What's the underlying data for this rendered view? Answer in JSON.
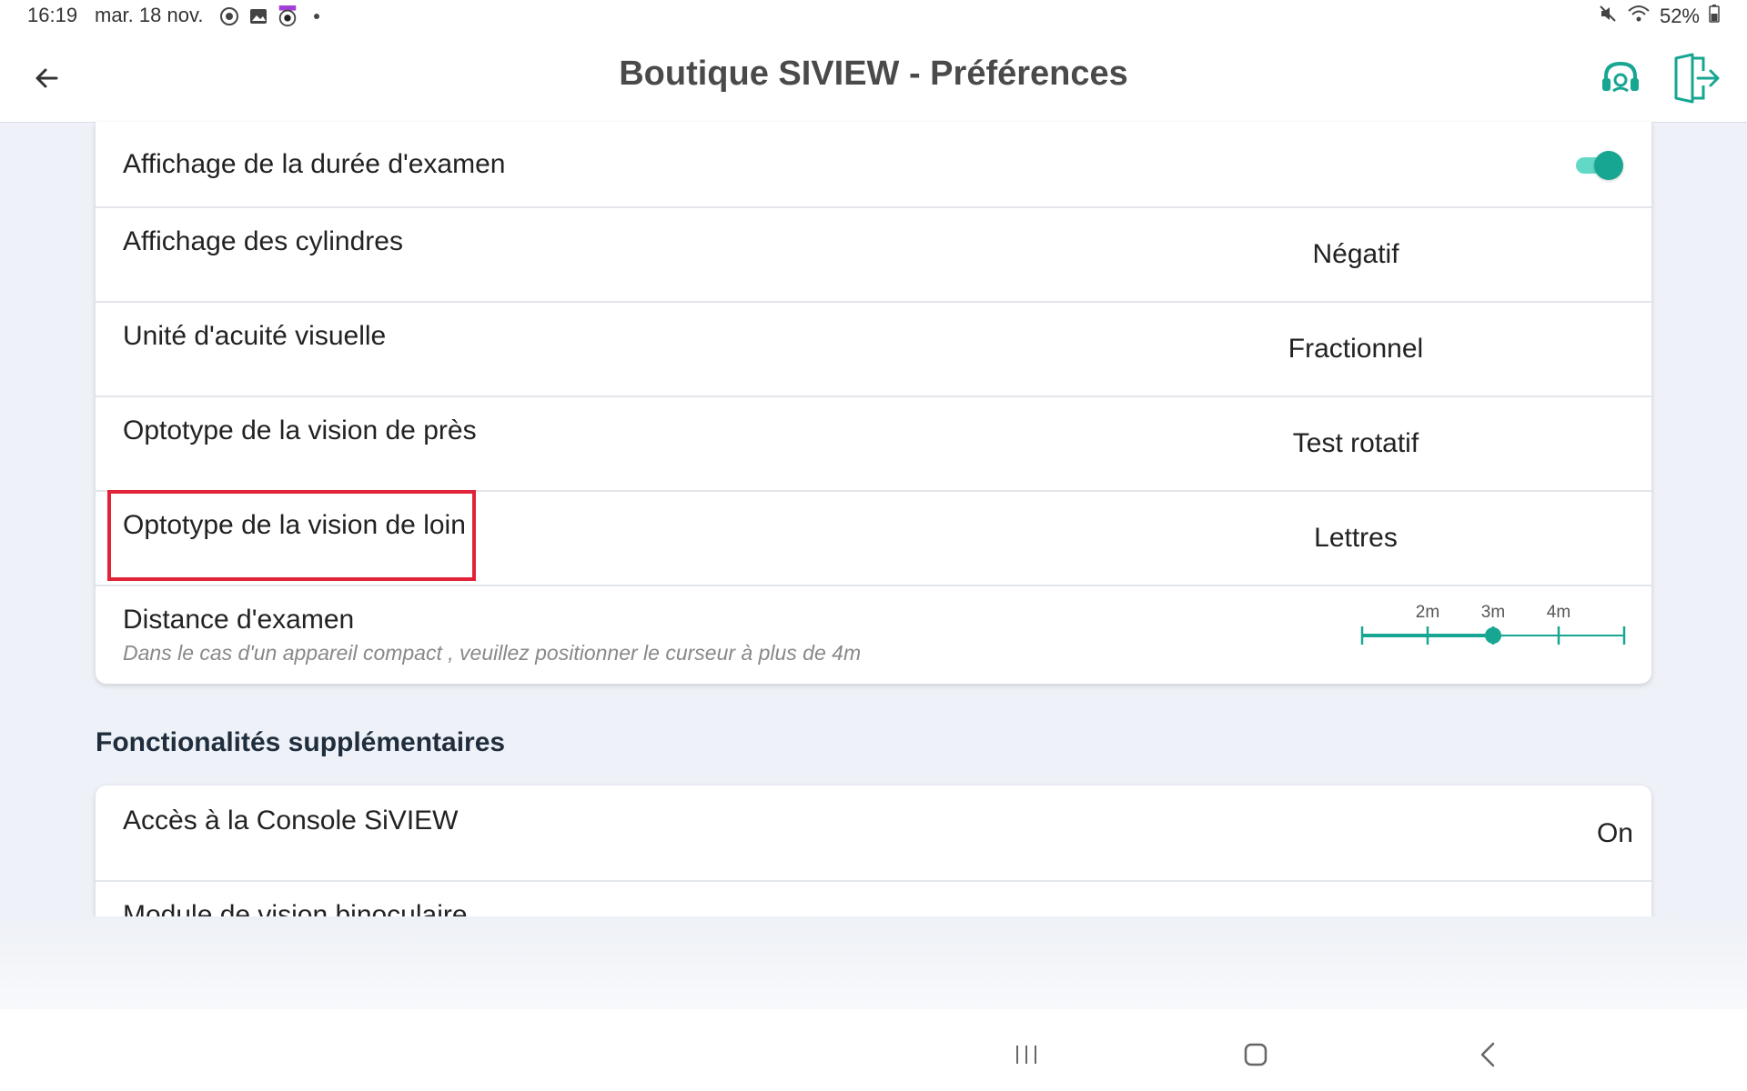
{
  "status_bar": {
    "time": "16:19",
    "date": "mar. 18 nov.",
    "battery": "52%"
  },
  "header": {
    "title": "Boutique SIVIEW  - Préférences"
  },
  "settings": [
    {
      "label": "Affichage de la durée d'examen",
      "toggle": true
    },
    {
      "label": "Affichage des cylindres",
      "value": "Négatif"
    },
    {
      "label": "Unité d'acuité visuelle",
      "value": "Fractionnel"
    },
    {
      "label": "Optotype de la vision de près",
      "value": "Test rotatif"
    },
    {
      "label": "Optotype de la vision de loin",
      "value": "Lettres"
    },
    {
      "label": "Distance d'examen",
      "hint": "Dans le cas d'un appareil compact , veuillez positionner le curseur à plus de 4m",
      "slider": {
        "ticks": [
          "2m",
          "3m",
          "4m"
        ],
        "selected": "3m"
      }
    }
  ],
  "extra_section": {
    "title": "Fonctionalités supplémentaires",
    "items": [
      {
        "label": "Accès à la Console SiVIEW",
        "value": "On"
      },
      {
        "label": "Module de vision binoculaire"
      }
    ]
  },
  "colors": {
    "accent": "#17a692",
    "toggle_track": "#62d9c6",
    "highlight": "#e1233a"
  }
}
